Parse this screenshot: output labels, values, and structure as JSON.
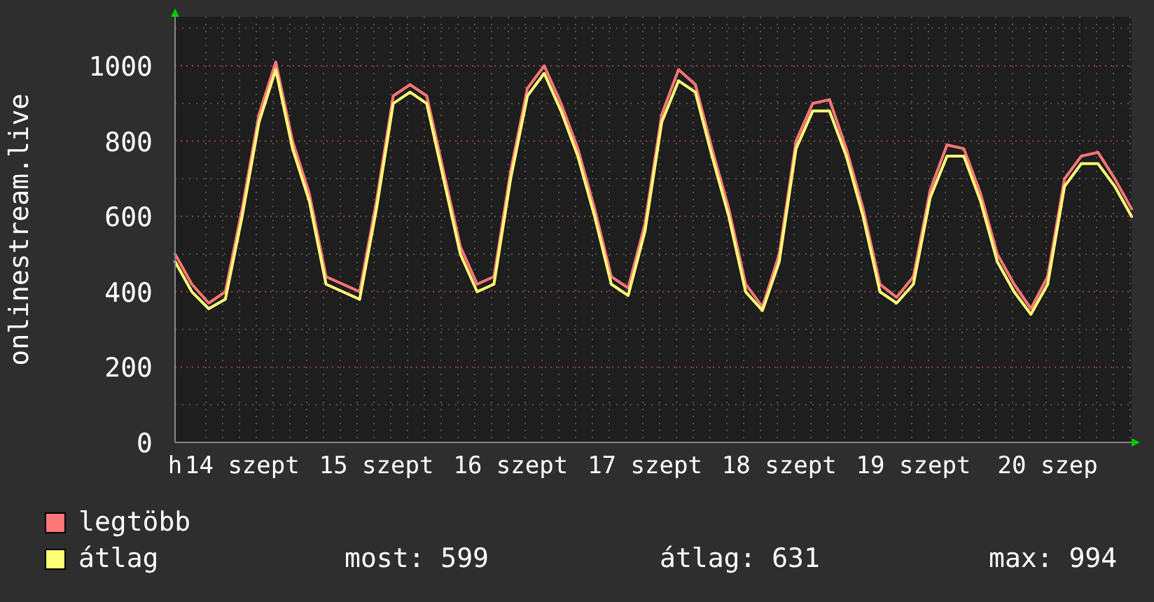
{
  "chart": {
    "chart_data": {
      "type": "line",
      "ylabel": "onlinestream.live",
      "categories": [
        "h",
        null,
        null,
        null,
        "14 szept",
        null,
        null,
        null,
        null,
        null,
        null,
        null,
        "15 szept",
        null,
        null,
        null,
        null,
        null,
        null,
        null,
        "16 szept",
        null,
        null,
        null,
        null,
        null,
        null,
        null,
        "17 szept",
        null,
        null,
        null,
        null,
        null,
        null,
        null,
        "18 szept",
        null,
        null,
        null,
        null,
        null,
        null,
        null,
        "19 szept",
        null,
        null,
        null,
        null,
        null,
        null,
        null,
        "20 szep",
        null,
        null,
        null,
        null,
        null
      ],
      "grid": true,
      "series": [
        {
          "name": "legtöbb",
          "color": "#ff7777",
          "values": [
            500,
            420,
            370,
            400,
            620,
            870,
            1010,
            800,
            660,
            440,
            420,
            400,
            640,
            920,
            950,
            920,
            720,
            520,
            420,
            440,
            720,
            940,
            1000,
            900,
            780,
            620,
            440,
            410,
            580,
            870,
            990,
            950,
            780,
            620,
            420,
            360,
            500,
            800,
            900,
            910,
            780,
            620,
            420,
            385,
            440,
            670,
            790,
            780,
            660,
            500,
            420,
            355,
            440,
            700,
            760,
            770,
            700,
            620
          ]
        },
        {
          "name": "átlag",
          "color": "#ffff77",
          "values": [
            480,
            400,
            355,
            380,
            600,
            850,
            990,
            780,
            640,
            420,
            400,
            380,
            620,
            900,
            930,
            900,
            700,
            500,
            400,
            420,
            700,
            920,
            980,
            880,
            760,
            600,
            420,
            390,
            560,
            850,
            960,
            930,
            760,
            600,
            400,
            350,
            480,
            780,
            880,
            880,
            760,
            600,
            400,
            370,
            420,
            650,
            760,
            760,
            640,
            480,
            400,
            340,
            420,
            680,
            740,
            740,
            680,
            600
          ]
        }
      ],
      "ylim": [
        0,
        1130
      ],
      "yticks": [
        0,
        200,
        400,
        600,
        800,
        1000
      ]
    }
  },
  "stats": [
    "most: 599",
    "átlag: 631",
    "max: 994"
  ]
}
